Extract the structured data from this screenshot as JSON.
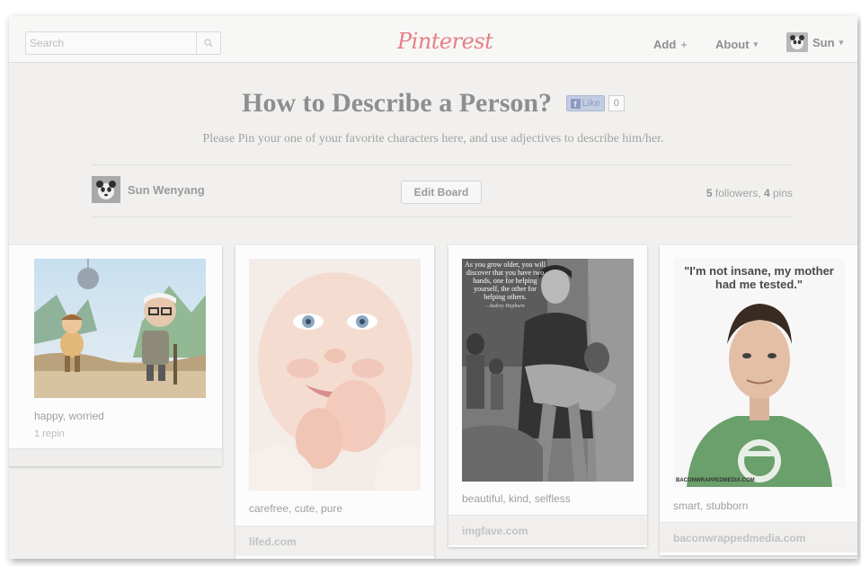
{
  "header": {
    "search_placeholder": "Search",
    "logo": "Pinterest",
    "add_label": "Add",
    "add_symbol": "+",
    "about_label": "About",
    "user_name": "Sun",
    "caret": "▾"
  },
  "board": {
    "title": "How to Describe a Person?",
    "like_label": "Like",
    "like_icon_letter": "f",
    "like_count": "0",
    "description": "Please Pin your one of your favorite characters here, and use adjectives to describe him/her.",
    "owner_name": "Sun Wenyang",
    "edit_label": "Edit Board",
    "followers_count": "5",
    "followers_label": "followers,",
    "pins_count": "4",
    "pins_label": "pins"
  },
  "pins": [
    {
      "caption": "happy, worried",
      "meta": "1 repin",
      "source": ""
    },
    {
      "caption": "carefree, cute, pure",
      "meta": "",
      "source": "lifed.com"
    },
    {
      "caption": "beautiful, kind, selfless",
      "meta": "",
      "source": "imgfave.com",
      "quote": "As you grow older, you will discover that you have two hands, one for helping yourself, the other for helping others.",
      "quote_author": "- Audrey Hepburn"
    },
    {
      "caption": "smart, stubborn",
      "meta": "",
      "source": "baconwrappedmedia.com",
      "quote": "\"I'm not insane, my mother had me tested.\"",
      "watermark": "BACONWRAPPEDMEDIA.COM"
    }
  ],
  "colors": {
    "logo": "#e67f84",
    "background": "#f1f0ee",
    "like_button": "#c3cde2"
  },
  "icons": {
    "search": "search-icon",
    "user_avatar": "panda-avatar-icon"
  }
}
